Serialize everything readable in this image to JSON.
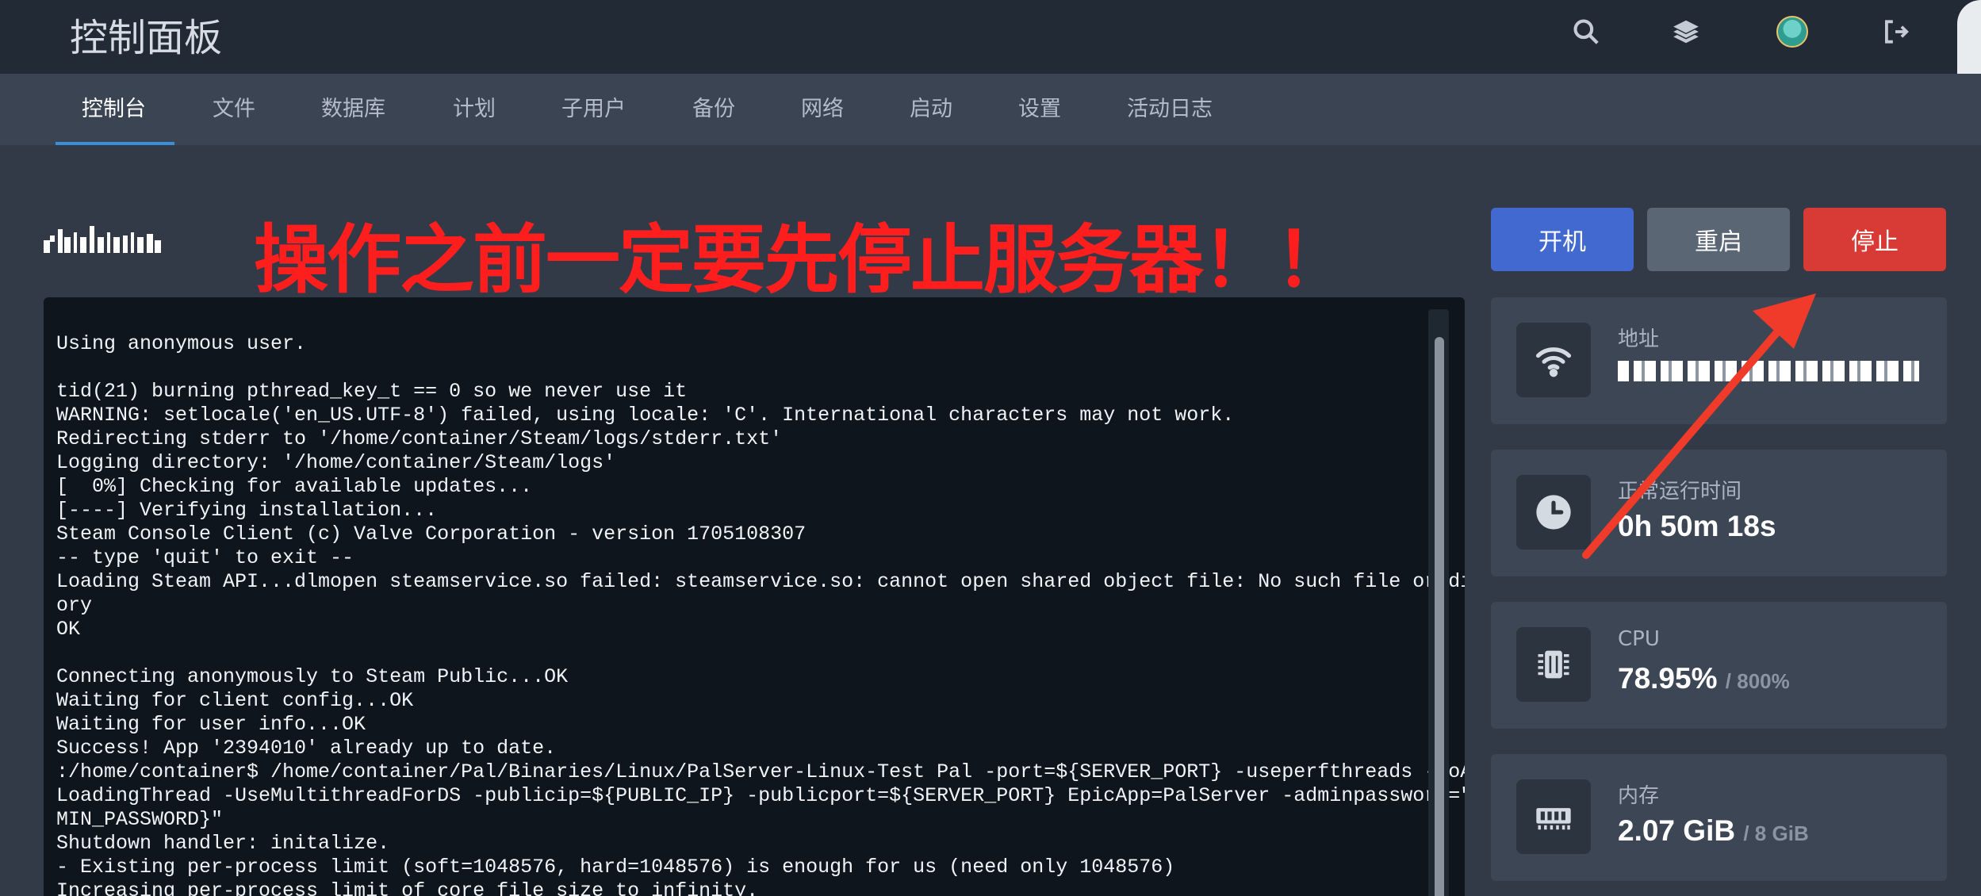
{
  "header": {
    "title": "控制面板",
    "icons": [
      "search-icon",
      "layers-icon",
      "avatar",
      "logout-icon"
    ]
  },
  "nav": {
    "tabs": [
      {
        "label": "控制台",
        "active": true
      },
      {
        "label": "文件"
      },
      {
        "label": "数据库"
      },
      {
        "label": "计划"
      },
      {
        "label": "子用户"
      },
      {
        "label": "备份"
      },
      {
        "label": "网络"
      },
      {
        "label": "启动"
      },
      {
        "label": "设置"
      },
      {
        "label": "活动日志"
      }
    ]
  },
  "warning": "操作之前一定要先停止服务器！！",
  "power": {
    "start_label": "开机",
    "restart_label": "重启",
    "stop_label": "停止"
  },
  "console": {
    "lines": [
      "Using anonymous user.",
      "",
      "tid(21) burning pthread_key_t == 0 so we never use it",
      "WARNING: setlocale('en_US.UTF-8') failed, using locale: 'C'. International characters may not work.",
      "Redirecting stderr to '/home/container/Steam/logs/stderr.txt'",
      "Logging directory: '/home/container/Steam/logs'",
      "[  0%] Checking for available updates...",
      "[----] Verifying installation...",
      "Steam Console Client (c) Valve Corporation - version 1705108307",
      "-- type 'quit' to exit --",
      "Loading Steam API...dlmopen steamservice.so failed: steamservice.so: cannot open shared object file: No such file or direct",
      "ory",
      "OK",
      "",
      "Connecting anonymously to Steam Public...OK",
      "Waiting for client config...OK",
      "Waiting for user info...OK",
      "Success! App '2394010' already up to date.",
      ":/home/container$ /home/container/Pal/Binaries/Linux/PalServer-Linux-Test Pal -port=${SERVER_PORT} -useperfthreads -NoAsync",
      "LoadingThread -UseMultithreadForDS -publicip=${PUBLIC_IP} -publicport=${SERVER_PORT} EpicApp=PalServer -adminpassword=\"${AD",
      "MIN_PASSWORD}\"",
      "Shutdown handler: initalize.",
      "- Existing per-process limit (soft=1048576, hard=1048576) is enough for us (need only 1048576)",
      "Increasing per-process limit of core file size to infinity."
    ]
  },
  "stats": {
    "address": {
      "label": "地址",
      "icon": "wifi-icon"
    },
    "uptime": {
      "label": "正常运行时间",
      "value": "0h 50m 18s",
      "icon": "clock-icon"
    },
    "cpu": {
      "label": "CPU",
      "value": "78.95%",
      "limit": "/ 800%",
      "icon": "cpu-icon"
    },
    "memory": {
      "label": "内存",
      "value": "2.07 GiB",
      "limit": "/ 8 GiB",
      "icon": "memory-icon"
    }
  },
  "colors": {
    "accent": "#3b8fd9",
    "start": "#4269cf",
    "restart": "#5b6675",
    "stop": "#d83a35",
    "warning": "#ff1e1e"
  }
}
